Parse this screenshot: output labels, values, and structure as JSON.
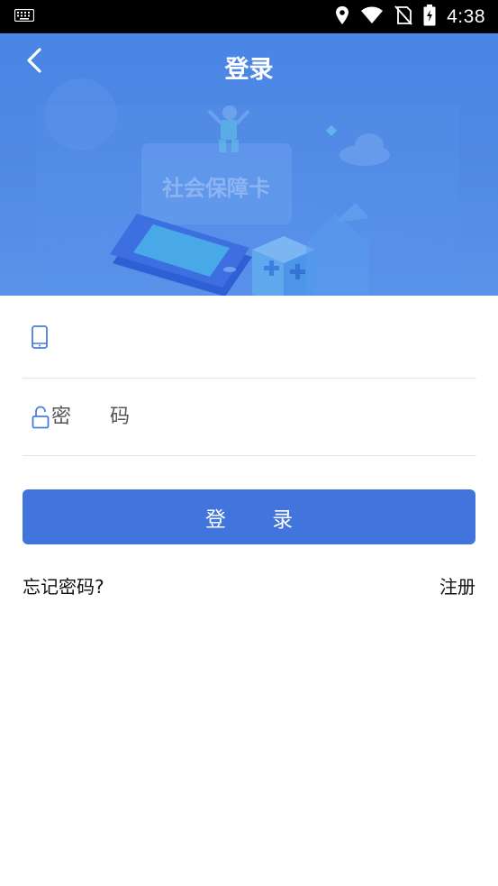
{
  "status_bar": {
    "time": "4:38",
    "icons": [
      "keyboard-icon",
      "location-icon",
      "wifi-icon",
      "no-sim-icon",
      "battery-charging-icon"
    ]
  },
  "header": {
    "title": "登录",
    "back_icon": "chevron-left-icon",
    "banner_card_text": "社会保障卡",
    "background_color": "#4a86e6"
  },
  "form": {
    "phone_field": {
      "icon": "mobile-phone-icon",
      "value": "",
      "placeholder": ""
    },
    "password_field": {
      "icon": "lock-open-icon",
      "value": "",
      "placeholder": "密 码"
    }
  },
  "login_button": {
    "label": "登 录",
    "color": "#4274dd"
  },
  "links": {
    "forgot_password": "忘记密码?",
    "register": "注册"
  }
}
